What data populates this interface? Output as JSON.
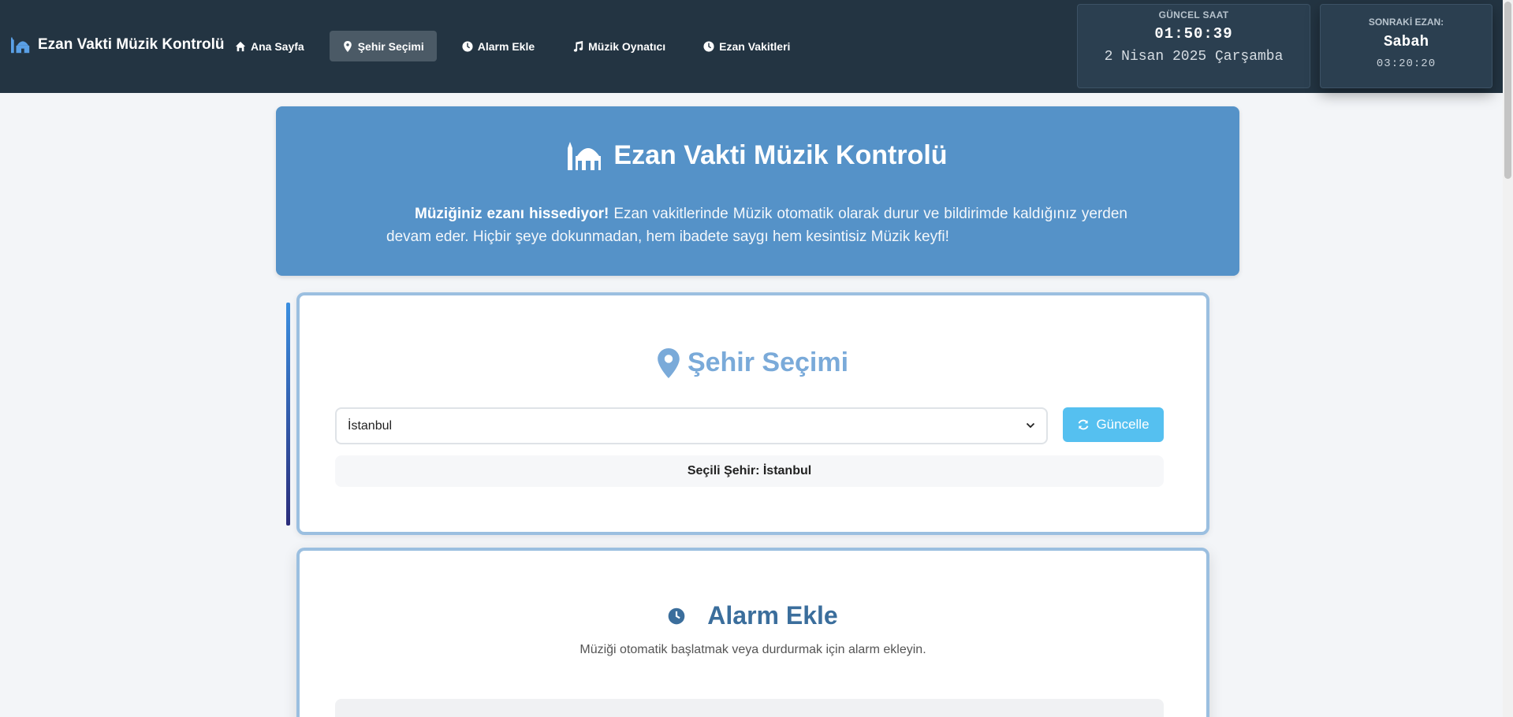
{
  "brand": {
    "title": "Ezan Vakti Müzik Kontrolü",
    "icon": "mosque-icon"
  },
  "nav": [
    {
      "label": "Ana Sayfa",
      "icon": "home-icon",
      "active": false
    },
    {
      "label": "Şehir Seçimi",
      "icon": "map-pin-icon",
      "active": true
    },
    {
      "label": "Alarm Ekle",
      "icon": "clock-icon",
      "active": false
    },
    {
      "label": "Müzik Oynatıcı",
      "icon": "music-icon",
      "active": false
    },
    {
      "label": "Ezan Vakitleri",
      "icon": "clock-icon",
      "active": false
    }
  ],
  "clock": {
    "label": "GÜNCEL SAAT",
    "time": "01:50:39",
    "date": "2 Nisan 2025 Çarşamba"
  },
  "next_prayer": {
    "label": "SONRAKİ EZAN:",
    "name": "Sabah",
    "countdown": "03:20:20"
  },
  "hero": {
    "title": "Ezan Vakti Müzik Kontrolü",
    "lead": "Müziğiniz ezanı hissediyor!",
    "text": " Ezan vakitlerinde Müzik otomatik olarak durur ve bildirimde kaldığınız yerden devam eder. Hiçbir şeye dokunmadan, hem ibadete saygı hem kesintisiz Müzik keyfi!"
  },
  "city": {
    "title": "Şehir Seçimi",
    "selected_value": "İstanbul",
    "refresh_label": "Güncelle",
    "selected_text": "Seçili Şehir: İstanbul"
  },
  "alarm": {
    "title": "Alarm Ekle",
    "description": "Müziği otomatik başlatmak veya durdurmak için alarm ekleyin."
  },
  "colors": {
    "navbar": "#233442",
    "hero": "#5592c8",
    "accent": "#7aaad9",
    "button": "#55c0f0",
    "card_border": "#9bbfe0"
  }
}
